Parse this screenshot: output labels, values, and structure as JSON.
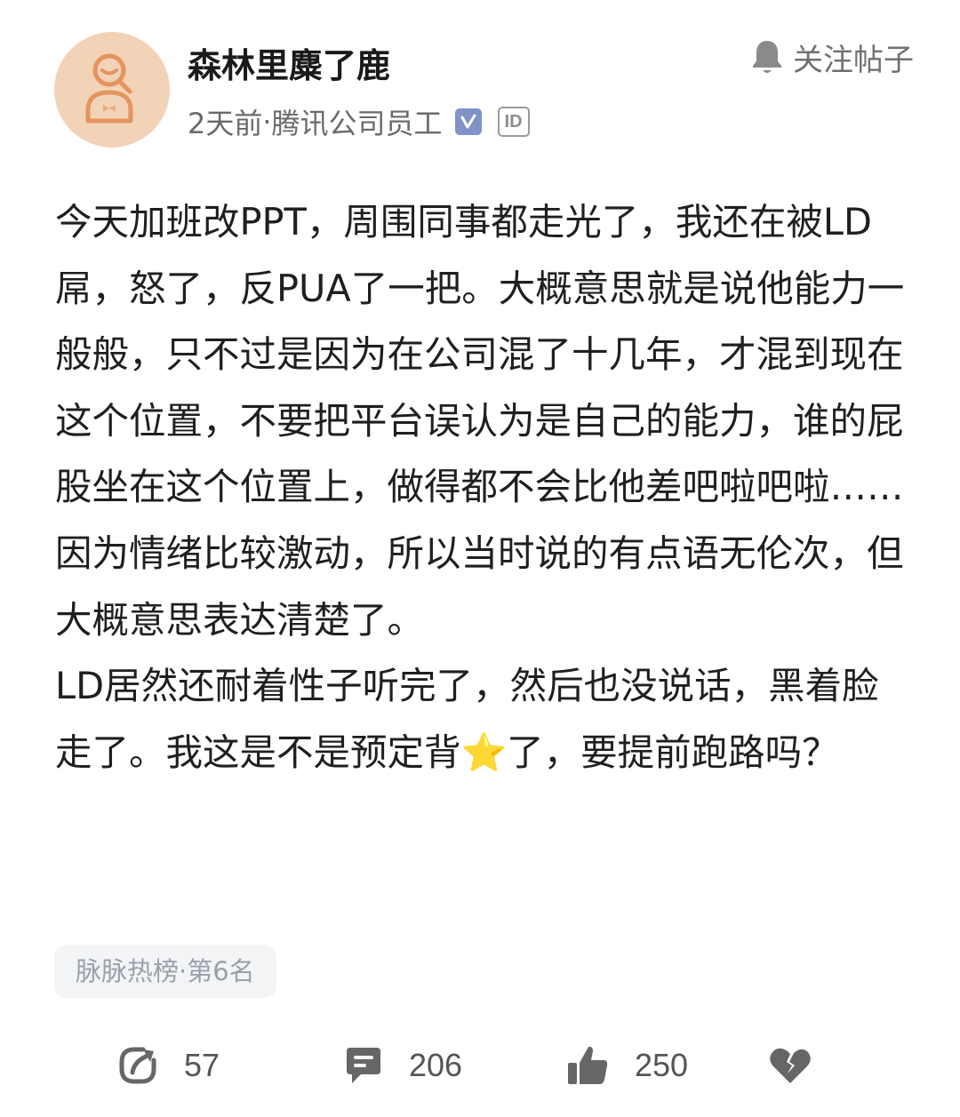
{
  "author": {
    "name": "森林里麋了鹿",
    "time": "2天前",
    "separator": "·",
    "company": "腾讯公司员工",
    "verified_icon": "verified-check-icon",
    "id_badge": "ID"
  },
  "follow": {
    "icon": "bell-icon",
    "label": "关注帖子"
  },
  "post": {
    "paragraphs": [
      "今天加班改PPT，周围同事都走光了，我还在被LD屌，怒了，反PUA了一把。大概意思就是说他能力一般般，只不过是因为在公司混了十几年，才混到现在这个位置，不要把平台误认为是自己的能力，谁的屁股坐在这个位置上，做得都不会比他差吧啦吧啦……因为情绪比较激动，所以当时说的有点语无伦次，但大概意思表达清楚了。",
      "LD居然还耐着性子听完了，然后也没说话，黑着脸走了。我这是不是预定背⭐了，要提前跑路吗？"
    ]
  },
  "tag": {
    "label": "脉脉热榜·第6名"
  },
  "actions": {
    "share": {
      "icon": "share-icon",
      "count": "57"
    },
    "comment": {
      "icon": "comment-icon",
      "count": "206"
    },
    "like": {
      "icon": "thumbs-up-icon",
      "count": "250"
    },
    "dislike": {
      "icon": "broken-heart-icon"
    }
  },
  "colors": {
    "avatar_bg": "#f3d3b8",
    "avatar_line": "#e3955d",
    "verified": "#7f93c8",
    "icon_gray": "#666666",
    "chip_bg": "#f3f4f6"
  }
}
